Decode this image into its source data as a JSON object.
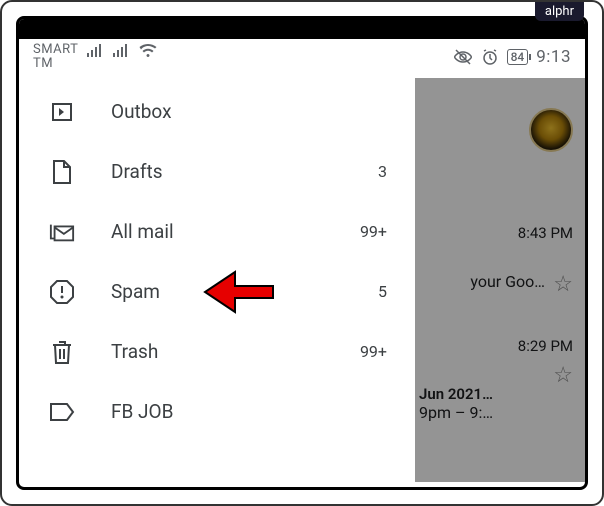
{
  "brand": "alphr",
  "status": {
    "carrier_line1": "SMART",
    "carrier_line2": "TM",
    "battery": "84",
    "time": "9:13"
  },
  "drawer": {
    "items": [
      {
        "label": "Outbox",
        "count": ""
      },
      {
        "label": "Drafts",
        "count": "3"
      },
      {
        "label": "All mail",
        "count": "99+"
      },
      {
        "label": "Spam",
        "count": "5"
      },
      {
        "label": "Trash",
        "count": "99+"
      },
      {
        "label": "FB JOB",
        "count": ""
      }
    ]
  },
  "background": {
    "mail1": {
      "time": "8:43 PM",
      "snippet": "your Goo…"
    },
    "mail2": {
      "time": "8:29 PM",
      "title": "Jun 2021…",
      "snippet": "9pm – 9:…"
    }
  }
}
